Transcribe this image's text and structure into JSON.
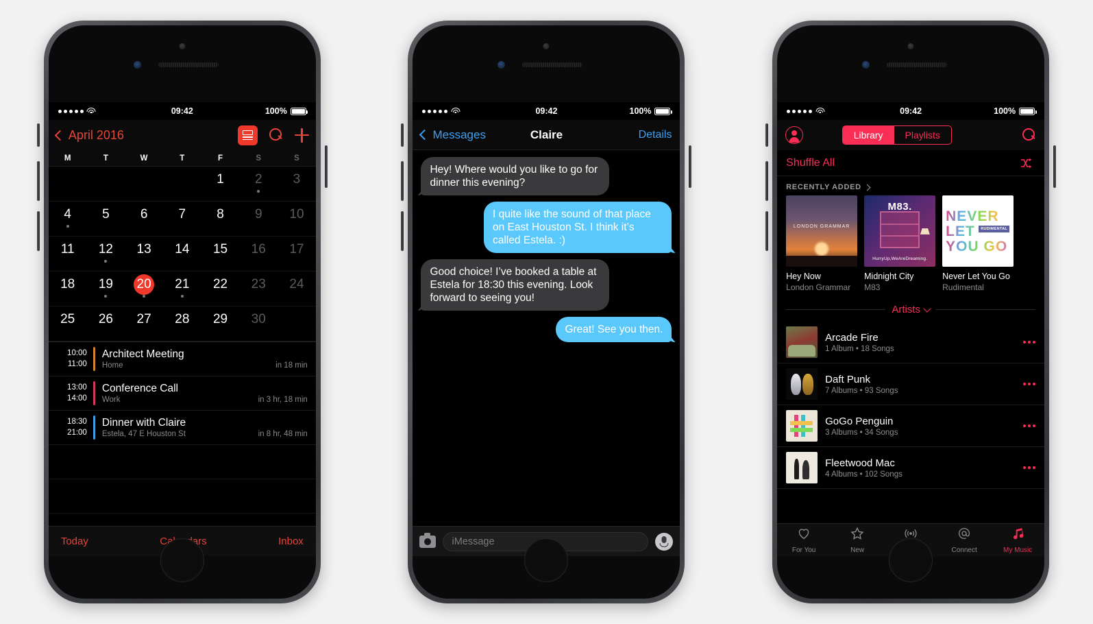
{
  "statusbar": {
    "time": "09:42",
    "battery_pct": "100%"
  },
  "calendar": {
    "back_label": "April 2016",
    "icons": {
      "list_view": "list-view-icon",
      "search": "search-icon",
      "add": "plus-icon",
      "back": "chevron-left-icon"
    },
    "weekdays": [
      "M",
      "T",
      "W",
      "T",
      "F",
      "S",
      "S"
    ],
    "weeks": [
      [
        {
          "n": "",
          "blank": true
        },
        {
          "n": "",
          "blank": true
        },
        {
          "n": "",
          "blank": true
        },
        {
          "n": "",
          "blank": true
        },
        {
          "n": "1"
        },
        {
          "n": "2",
          "dim": true,
          "dot": true
        },
        {
          "n": "3",
          "dim": true
        }
      ],
      [
        {
          "n": "4",
          "dot": true
        },
        {
          "n": "5"
        },
        {
          "n": "6"
        },
        {
          "n": "7"
        },
        {
          "n": "8"
        },
        {
          "n": "9",
          "dim": true
        },
        {
          "n": "10",
          "dim": true
        }
      ],
      [
        {
          "n": "11"
        },
        {
          "n": "12",
          "dot": true
        },
        {
          "n": "13"
        },
        {
          "n": "14"
        },
        {
          "n": "15"
        },
        {
          "n": "16",
          "dim": true
        },
        {
          "n": "17",
          "dim": true
        }
      ],
      [
        {
          "n": "18"
        },
        {
          "n": "19",
          "dot": true
        },
        {
          "n": "20",
          "today": true,
          "dot": true
        },
        {
          "n": "21",
          "dot": true
        },
        {
          "n": "22"
        },
        {
          "n": "23",
          "dim": true
        },
        {
          "n": "24",
          "dim": true
        }
      ],
      [
        {
          "n": "25"
        },
        {
          "n": "26"
        },
        {
          "n": "27"
        },
        {
          "n": "28"
        },
        {
          "n": "29"
        },
        {
          "n": "30",
          "dim": true
        },
        {
          "n": "",
          "blank": true
        }
      ]
    ],
    "events": [
      {
        "start": "10:00",
        "end": "11:00",
        "title": "Architect Meeting",
        "location": "Home",
        "relative": "in 18 min",
        "color": "#d4862a"
      },
      {
        "start": "13:00",
        "end": "14:00",
        "title": "Conference Call",
        "location": "Work",
        "relative": "in 3 hr, 18 min",
        "color": "#d6355c"
      },
      {
        "start": "18:30",
        "end": "21:00",
        "title": "Dinner with Claire",
        "location": "Estela, 47 E Houston St",
        "relative": "in 8 hr, 48 min",
        "color": "#3f9fe0"
      }
    ],
    "tabbar": [
      "Today",
      "Calendars",
      "Inbox"
    ],
    "accent": "#e8443a"
  },
  "messages": {
    "back_label": "Messages",
    "title": "Claire",
    "details_label": "Details",
    "accent": "#3fa0f5",
    "bubbles": [
      {
        "from": "them",
        "text": "Hey! Where would you like to go for dinner this evening?"
      },
      {
        "from": "me",
        "text": "I quite like the sound of that place on East Houston St. I think it’s called Estela. :)"
      },
      {
        "from": "them",
        "text": "Good choice! I’ve booked a table at Estela for 18:30 this evening. Look forward to seeing you!"
      },
      {
        "from": "me",
        "text": "Great! See you then."
      }
    ],
    "input": {
      "placeholder": "iMessage",
      "camera_icon": "camera-icon",
      "mic_icon": "microphone-icon"
    },
    "bubble_colors": {
      "them": "#3a3a3c",
      "me": "#5ac8fa"
    }
  },
  "music": {
    "accent": "#fa2d55",
    "segments": [
      {
        "label": "Library",
        "active": true
      },
      {
        "label": "Playlists",
        "active": false
      }
    ],
    "shuffle_label": "Shuffle All",
    "section_label": "RECENTLY ADDED",
    "albums": [
      {
        "title": "Hey Now",
        "artist": "London Grammar",
        "art": "sunset",
        "art_text": "LONDON GRAMMAR"
      },
      {
        "title": "Midnight City",
        "artist": "M83",
        "art": "m83",
        "art_text": "M83.",
        "art_subtext": "HurryUp,WeAreDreaming."
      },
      {
        "title": "Never Let You Go",
        "artist": "Rudimental",
        "art": "nlyg",
        "art_lines": [
          "NEVER",
          "LET",
          "YOU GO"
        ],
        "art_tag": "RUDIMENTAL"
      }
    ],
    "artists_header": "Artists",
    "artists": [
      {
        "name": "Arcade Fire",
        "meta": "1 Album • 18 Songs",
        "art": "arcade"
      },
      {
        "name": "Daft Punk",
        "meta": "7 Albums • 93 Songs",
        "art": "daft"
      },
      {
        "name": "GoGo Penguin",
        "meta": "3 Albums • 34 Songs",
        "art": "gogo"
      },
      {
        "name": "Fleetwood Mac",
        "meta": "4 Albums • 102 Songs",
        "art": "fleet"
      }
    ],
    "tabs": [
      {
        "label": "For You",
        "icon": "heart-icon",
        "active": false
      },
      {
        "label": "New",
        "icon": "star-icon",
        "active": false
      },
      {
        "label": "Radio",
        "icon": "radio-icon",
        "active": false
      },
      {
        "label": "Connect",
        "icon": "at-icon",
        "active": false
      },
      {
        "label": "My Music",
        "icon": "music-note-icon",
        "active": true
      }
    ]
  }
}
